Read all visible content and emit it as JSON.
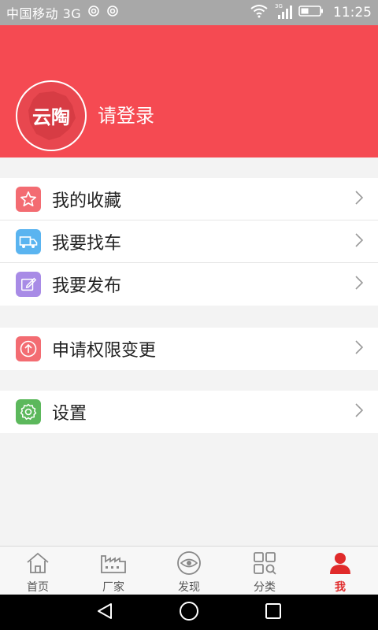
{
  "status_bar": {
    "carrier": "中国移动 3G",
    "network_type": "3G",
    "time": "11:25"
  },
  "header": {
    "avatar_logo_text": "云陶",
    "login_prompt": "请登录",
    "background_color": "#f54a52"
  },
  "menu": {
    "group1": [
      {
        "label": "我的收藏",
        "icon": "star-icon",
        "icon_color": "#f36c72"
      },
      {
        "label": "我要找车",
        "icon": "truck-icon",
        "icon_color": "#5ab4f0"
      },
      {
        "label": "我要发布",
        "icon": "edit-icon",
        "icon_color": "#a88be6"
      }
    ],
    "group2": [
      {
        "label": "申请权限变更",
        "icon": "upload-icon",
        "icon_color": "#f36c72"
      }
    ],
    "group3": [
      {
        "label": "设置",
        "icon": "gear-icon",
        "icon_color": "#5cb85c"
      }
    ]
  },
  "tabbar": {
    "items": [
      {
        "label": "首页",
        "icon": "home-icon",
        "active": false
      },
      {
        "label": "厂家",
        "icon": "factory-icon",
        "active": false
      },
      {
        "label": "发现",
        "icon": "eye-icon",
        "active": false
      },
      {
        "label": "分类",
        "icon": "category-icon",
        "active": false
      },
      {
        "label": "我",
        "icon": "user-icon",
        "active": true
      }
    ],
    "active_color": "#e02a2a"
  }
}
